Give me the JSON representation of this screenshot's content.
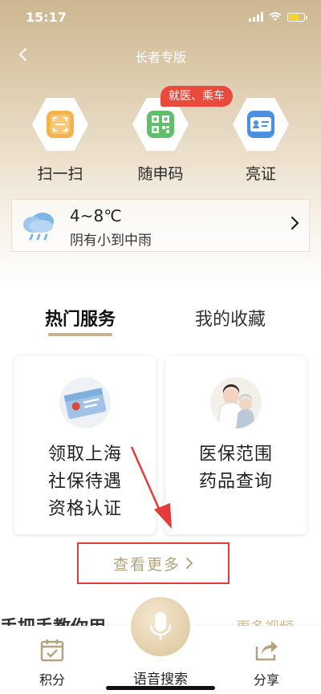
{
  "status_bar": {
    "time": "15:17"
  },
  "nav": {
    "title": "长者专版"
  },
  "quick_actions": [
    {
      "label": "扫一扫",
      "icon": "scan-icon"
    },
    {
      "label": "随申码",
      "icon": "qr-code-icon"
    },
    {
      "label": "亮证",
      "icon": "id-card-icon"
    }
  ],
  "badge": {
    "text": "就医、乘车"
  },
  "weather": {
    "temp": "4~8℃",
    "desc": "阴有小到中雨",
    "icon": "rain-cloud-icon"
  },
  "tabs": [
    {
      "label": "热门服务",
      "active": true
    },
    {
      "label": "我的收藏",
      "active": false
    }
  ],
  "cards": [
    {
      "lines": [
        "领取上海",
        "社保待遇",
        "资格认证"
      ],
      "icon": "social-security-card-icon"
    },
    {
      "lines": [
        "医保范围",
        "药品查询"
      ],
      "icon": "doctor-avatar-icon"
    }
  ],
  "more": {
    "label": "查看更多"
  },
  "below_fold": {
    "left": "手把手教你用",
    "right": "更多视频"
  },
  "bottom_bar": {
    "points_label": "积分",
    "voice_label": "语音搜索",
    "share_label": "分享"
  },
  "colors": {
    "accent": "#c8b48c",
    "badge": "#e94a3c",
    "annotation": "#e33b3b"
  }
}
